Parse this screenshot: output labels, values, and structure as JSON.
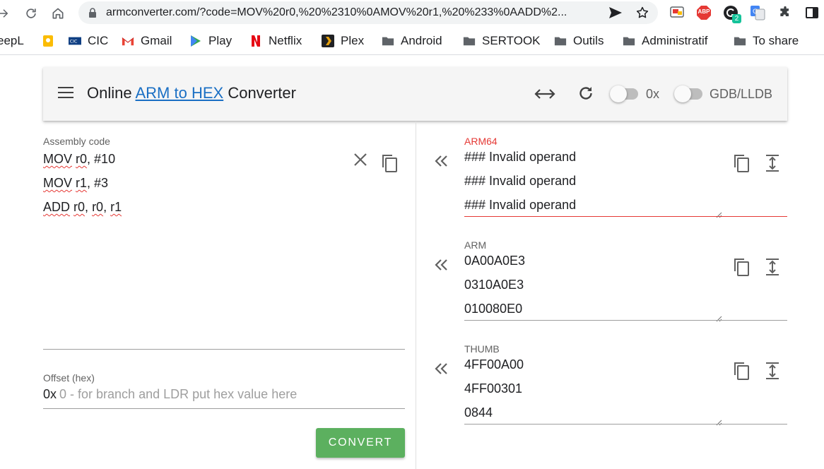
{
  "browser": {
    "url": "armconverter.com/?code=MOV%20r0,%20%2310%0AMOV%20r1,%20%233%0AADD%2...",
    "extension_badge": "2",
    "extensions": {
      "abp_label": "ABP"
    },
    "bookmarks": [
      {
        "label": "eepL",
        "icon": "deepl-icon"
      },
      {
        "label": "",
        "icon": "keep-icon"
      },
      {
        "label": "CIC",
        "icon": "cic-icon"
      },
      {
        "label": "Gmail",
        "icon": "gmail-icon"
      },
      {
        "label": "Play",
        "icon": "play-icon"
      },
      {
        "label": "Netflix",
        "icon": "netflix-icon"
      },
      {
        "label": "Plex",
        "icon": "plex-icon"
      },
      {
        "label": "Android",
        "icon": "folder-icon"
      },
      {
        "label": "SERTOOK",
        "icon": "folder-icon"
      },
      {
        "label": "Outils",
        "icon": "folder-icon"
      },
      {
        "label": "Administratif",
        "icon": "folder-icon"
      },
      {
        "label": "To share",
        "icon": "folder-icon"
      }
    ]
  },
  "app": {
    "title_prefix": "Online ",
    "title_link": "ARM to HEX",
    "title_suffix": " Converter",
    "toggle_hex_label": "0x",
    "toggle_debugger_label": "GDB/LLDB",
    "colors": {
      "accent_link": "#1a6fc4",
      "convert": "#5cb05f",
      "error": "#e53935"
    }
  },
  "input": {
    "label": "Assembly code",
    "lines": [
      [
        {
          "t": "MOV",
          "squig": true
        },
        {
          "t": " ",
          "squig": false
        },
        {
          "t": "r0",
          "squig": true
        },
        {
          "t": ", #10",
          "squig": false
        }
      ],
      [
        {
          "t": "MOV",
          "squig": true
        },
        {
          "t": " ",
          "squig": false
        },
        {
          "t": "r1",
          "squig": true
        },
        {
          "t": ", #3",
          "squig": false
        }
      ],
      [
        {
          "t": "ADD",
          "squig": true
        },
        {
          "t": " ",
          "squig": false
        },
        {
          "t": "r0",
          "squig": true
        },
        {
          "t": ", ",
          "squig": false
        },
        {
          "t": "r0",
          "squig": true
        },
        {
          "t": ", ",
          "squig": false
        },
        {
          "t": "r1",
          "squig": true
        }
      ]
    ],
    "offset_label": "Offset (hex)",
    "offset_prefix": "0x",
    "offset_placeholder": "0 - for branch and LDR put hex value here",
    "convert_label": "CONVERT"
  },
  "outputs": [
    {
      "label": "ARM64",
      "error": true,
      "lines": [
        "### Invalid operand",
        "### Invalid operand",
        "### Invalid operand"
      ]
    },
    {
      "label": "ARM",
      "error": false,
      "lines": [
        "0A00A0E3",
        "0310A0E3",
        "010080E0"
      ]
    },
    {
      "label": "THUMB",
      "error": false,
      "lines": [
        "4FF00A00",
        "4FF00301",
        "0844"
      ]
    }
  ]
}
